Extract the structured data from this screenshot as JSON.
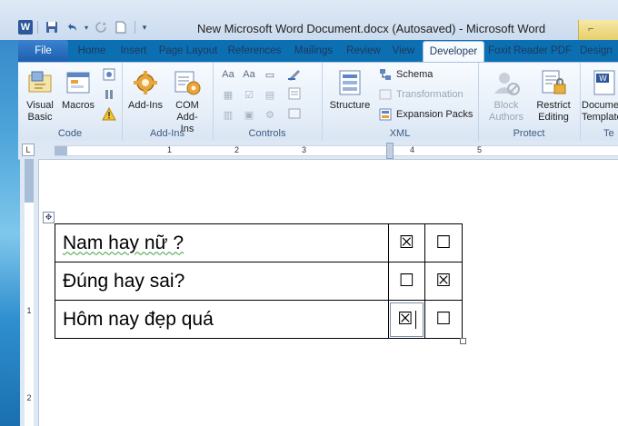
{
  "title_bar": {
    "app_icon": "W",
    "document_title": "New Microsoft Word Document.docx (Autosaved)  -  Microsoft Word"
  },
  "quick_access": [
    "save-icon",
    "undo-icon",
    "redo-icon",
    "new-doc-icon",
    "customize-icon"
  ],
  "tabs": [
    {
      "label": "File"
    },
    {
      "label": "Home"
    },
    {
      "label": "Insert"
    },
    {
      "label": "Page Layout"
    },
    {
      "label": "References"
    },
    {
      "label": "Mailings"
    },
    {
      "label": "Review"
    },
    {
      "label": "View"
    },
    {
      "label": "Developer"
    },
    {
      "label": "Foxit Reader PDF"
    },
    {
      "label": "Design"
    }
  ],
  "active_tab": "Developer",
  "ribbon": {
    "code": {
      "label": "Code",
      "visual_basic": "Visual Basic",
      "macros": "Macros"
    },
    "addins": {
      "label": "Add-Ins",
      "add_ins": "Add-Ins",
      "com_add_ins": "COM Add-Ins"
    },
    "controls": {
      "label": "Controls",
      "items": [
        "Aa",
        "Aa",
        "▭",
        "▦",
        "☑",
        "▤",
        "▥",
        "▣",
        "⚙"
      ]
    },
    "xml": {
      "label": "XML",
      "structure": "Structure",
      "schema": "Schema",
      "transformation": "Transformation",
      "expansion_packs": "Expansion Packs"
    },
    "protect": {
      "label": "Protect",
      "block_authors": "Block Authors",
      "restrict_editing": "Restrict Editing"
    },
    "templates": {
      "label": "Te",
      "document_template": "Document Template"
    }
  },
  "ruler": {
    "h_numbers": [
      "1",
      "2",
      "3",
      "4",
      "5"
    ],
    "v_numbers": [
      "1",
      "2"
    ]
  },
  "table": {
    "rows": [
      {
        "question": "Nam hay nữ ?",
        "col1": "☒",
        "col2": "☐"
      },
      {
        "question": "Đúng hay sai?",
        "col1": "☐",
        "col2": "☒"
      },
      {
        "question": "Hôm nay đẹp quá",
        "col1": "☒",
        "col2": "☐"
      }
    ]
  },
  "colors": {
    "file_tab": "#1d5fb0",
    "ribbon_bg": "#e4edf8",
    "accent": "#2b579a"
  }
}
